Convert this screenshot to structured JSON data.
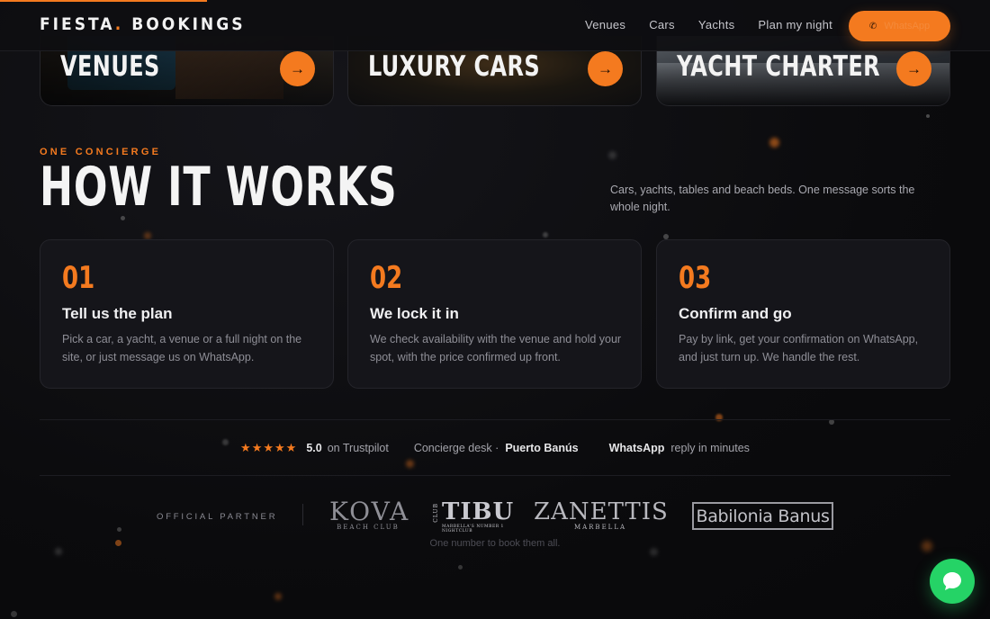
{
  "brand": {
    "name": "FIESTA",
    "dot": ".",
    "suffix": "BOOKINGS"
  },
  "nav": [
    {
      "label": "Venues"
    },
    {
      "label": "Cars"
    },
    {
      "label": "Yachts"
    },
    {
      "label": "Plan my night"
    }
  ],
  "header": {
    "cta_label": "WhatsApp",
    "cta_icon": "phone-icon"
  },
  "categories": [
    {
      "title": "VENUES",
      "icon": "arrow-right-icon"
    },
    {
      "title": "LUXURY CARS",
      "icon": "arrow-right-icon"
    },
    {
      "title": "YACHT CHARTER",
      "icon": "arrow-right-icon"
    }
  ],
  "how": {
    "eyebrow": "ONE CONCIERGE",
    "title": "HOW IT WORKS",
    "intro": "Cars, yachts, tables and beach beds. One message sorts the whole night.",
    "steps": [
      {
        "num": "01",
        "title": "Tell us the plan",
        "text": "Pick a car, a yacht, a venue or a full night on the site, or just message us on WhatsApp."
      },
      {
        "num": "02",
        "title": "We lock it in",
        "text": "We check availability with the venue and hold your spot, with the price confirmed up front."
      },
      {
        "num": "03",
        "title": "Confirm and go",
        "text": "Pay by link, get your confirmation on WhatsApp, and just turn up. We handle the rest."
      }
    ]
  },
  "trust": {
    "stars": "★★★★★",
    "rating": "5.0",
    "rating_suffix": "on Trustpilot",
    "desk_label": "Concierge desk ·",
    "desk_location": "Puerto Banús",
    "wa_label": "WhatsApp",
    "wa_suffix": "reply in minutes"
  },
  "partners": {
    "label": "OFFICIAL PARTNER",
    "logos": [
      {
        "name": "KOVA",
        "sub": "BEACH CLUB"
      },
      {
        "name": "TIBU",
        "side": "CLUB",
        "sub": "MARBELLA'S NUMBER 1 NIGHTCLUB"
      },
      {
        "name": "ZANETTIS",
        "sub": "MARBELLA"
      },
      {
        "name": "Babilonia Banus"
      }
    ],
    "tagline": "One number to book them all."
  },
  "colors": {
    "accent": "#f47a1f",
    "whatsapp": "#25d366",
    "background": "#0b0b0d"
  },
  "floating": {
    "chat_icon": "chat-bubble-icon"
  }
}
